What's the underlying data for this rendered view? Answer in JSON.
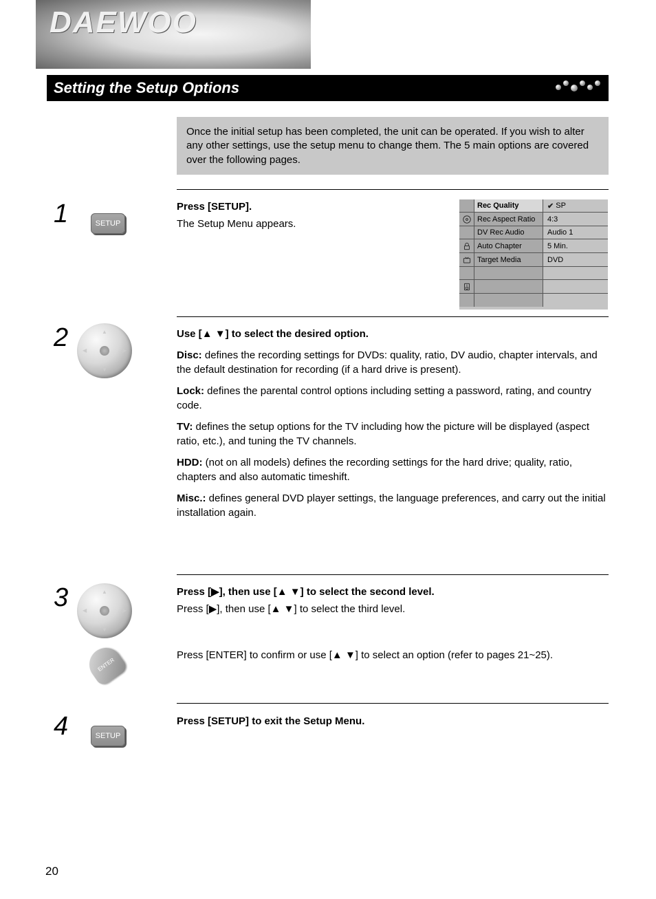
{
  "logo": "DAEWOO",
  "header": {
    "title": "Setting the Setup Options"
  },
  "intro": "Once the initial setup has been completed, the unit can be operated. If you wish to alter any other settings, use the setup menu to change them. The 5 main options are covered over the following pages.",
  "steps": {
    "s1": {
      "num": "1",
      "title": "Press [SETUP].",
      "text": "The Setup Menu appears."
    },
    "s2": {
      "num": "2",
      "title_pre": "Use [",
      "title_post": "] to select the desired option.",
      "disc_label": "Disc:",
      "disc_text": " defines the recording settings for DVDs: quality, ratio, DV audio, chapter intervals, and the default destination for recording (if a hard drive is present).",
      "lock_label": "Lock:",
      "lock_text": " defines the parental control options including setting a password, rating, and country code.",
      "tv_label": "TV:",
      "tv_text": " defines the setup options for the TV including how the picture will be displayed (aspect ratio, etc.), and tuning the TV channels.",
      "hdd_label": "HDD:",
      "hdd_text": " (not on all models) defines the recording settings for the hard drive; quality, ratio, chapters and also automatic timeshift.",
      "misc_label": "Misc.:",
      "misc_text": " defines general DVD player settings, the language preferences, and carry out the initial installation again."
    },
    "s3": {
      "num": "3",
      "title_pre": "Press [",
      "title_mid": "], then use [",
      "title_post": "] to select the second level.",
      "line2_pre": "Press [",
      "line2_mid": "], then use [",
      "line2_post": "] to select the third level.",
      "enter_pre": "Press [ENTER] to confirm or use [",
      "enter_post": "] to select an option (refer to pages 21~25)."
    },
    "s4": {
      "num": "4",
      "title": "Press [SETUP] to exit the Setup Menu."
    }
  },
  "osd": {
    "rows": [
      {
        "label": "Rec Quality",
        "value": "SP",
        "highlight": true,
        "check": true
      },
      {
        "icon": "disc",
        "label": "Rec Aspect Ratio",
        "value": "4:3"
      },
      {
        "label": "DV Rec Audio",
        "value": "Audio 1"
      },
      {
        "icon": "lock",
        "label": "Auto Chapter",
        "value": "5 Min."
      },
      {
        "icon": "tv",
        "label": "Target Media",
        "value": "DVD"
      },
      {
        "label": "",
        "value": "",
        "blank": true
      },
      {
        "icon": "speaker",
        "label": "",
        "value": ""
      },
      {
        "label": "",
        "value": "",
        "blank": true
      }
    ]
  },
  "glyphs": {
    "up": "▲",
    "down": "▼",
    "right": "▶",
    "check": "✔"
  },
  "buttons": {
    "setup": "SETUP",
    "enter": "ENTER"
  },
  "page_number": "20"
}
